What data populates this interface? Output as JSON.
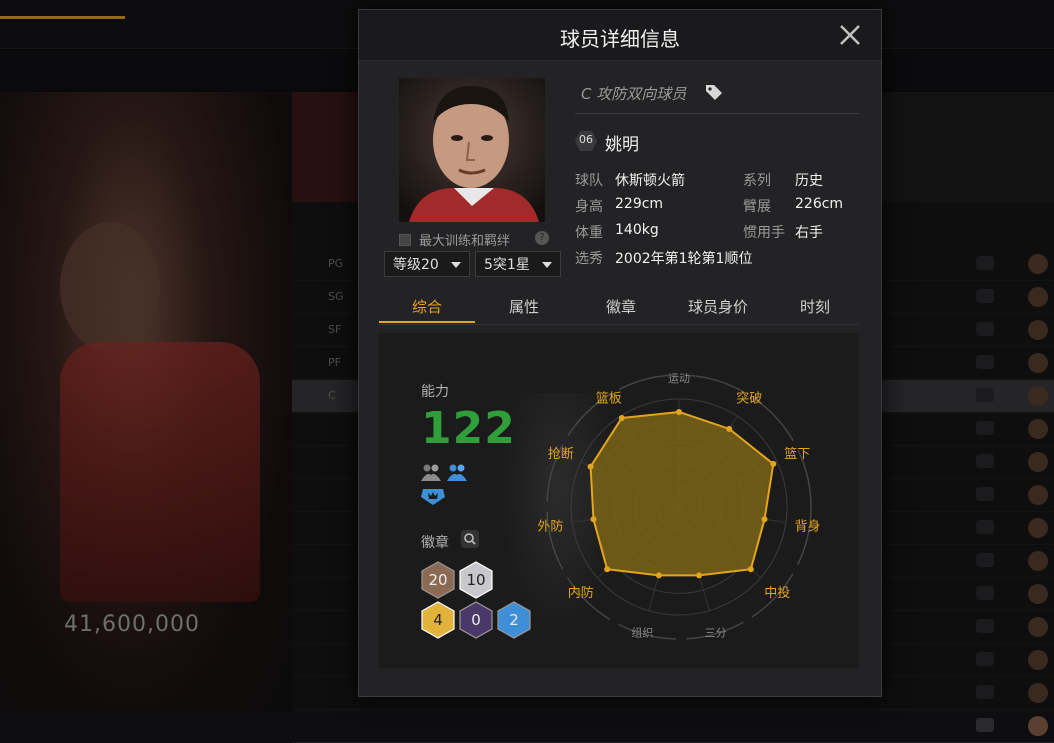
{
  "background": {
    "salary": "41,600,000",
    "positions": [
      "PG",
      "SG",
      "SF",
      "PF",
      "C",
      "",
      "",
      "",
      "",
      "",
      "",
      "",
      "",
      "",
      ""
    ]
  },
  "modal": {
    "title": "球员详细信息",
    "player": {
      "position_tag": "C 攻防双向球员",
      "number": "06",
      "name": "姚明",
      "info": [
        {
          "key": "球队",
          "value": "休斯顿火箭"
        },
        {
          "key": "系列",
          "value": "历史"
        },
        {
          "key": "身高",
          "value": "229cm"
        },
        {
          "key": "臂展",
          "value": "226cm"
        },
        {
          "key": "体重",
          "value": "140kg"
        },
        {
          "key": "惯用手",
          "value": "右手"
        },
        {
          "key": "选秀",
          "value": "2002年第1轮第1顺位"
        }
      ]
    },
    "training_label": "最大训练和羁绊",
    "level_select": "等级20",
    "star_select": "5突1星",
    "tabs": [
      "综合",
      "属性",
      "徽章",
      "球员身价",
      "时刻"
    ],
    "active_tab": "综合",
    "overview": {
      "ability_label": "能力",
      "ability_value": "122",
      "badge_label": "徽章",
      "badges": [
        {
          "value": "20",
          "tier": "bronze",
          "color": "#8a6a52"
        },
        {
          "value": "10",
          "tier": "silver",
          "color": "#c8c8cc"
        },
        {
          "value": "4",
          "tier": "gold",
          "color": "#e2b33c"
        },
        {
          "value": "0",
          "tier": "purple",
          "color": "#4a3868"
        },
        {
          "value": "2",
          "tier": "blue",
          "color": "#3f8ed8"
        }
      ],
      "radar": {
        "axes": [
          "运动",
          "突破",
          "篮下",
          "背身",
          "中投",
          "三分",
          "组织",
          "内防",
          "外防",
          "抢断",
          "篮板"
        ],
        "active_axes": [
          "突破",
          "篮下",
          "背身",
          "中投",
          "内防",
          "外防",
          "抢断",
          "篮板"
        ],
        "values": [
          0.88,
          0.86,
          0.96,
          0.8,
          0.88,
          0.66,
          0.66,
          0.88,
          0.8,
          0.9,
          0.98
        ],
        "fill": "#7a6418",
        "stroke": "#e3a51c"
      }
    }
  }
}
